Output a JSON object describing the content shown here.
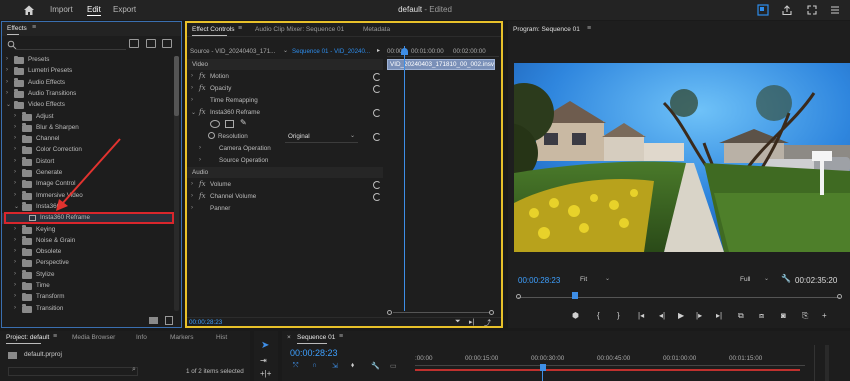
{
  "topbar": {
    "nav": [
      "Import",
      "Edit",
      "Export"
    ],
    "active_nav": "Edit",
    "doc_title": "default",
    "doc_status": "- Edited"
  },
  "effects_panel": {
    "title": "Effects",
    "tree": [
      {
        "label": "Presets",
        "level": 0,
        "state": "collapsed"
      },
      {
        "label": "Lumetri Presets",
        "level": 0,
        "state": "collapsed"
      },
      {
        "label": "Audio Effects",
        "level": 0,
        "state": "collapsed"
      },
      {
        "label": "Audio Transitions",
        "level": 0,
        "state": "collapsed"
      },
      {
        "label": "Video Effects",
        "level": 0,
        "state": "expanded"
      },
      {
        "label": "Adjust",
        "level": 1,
        "state": "collapsed"
      },
      {
        "label": "Blur & Sharpen",
        "level": 1,
        "state": "collapsed"
      },
      {
        "label": "Channel",
        "level": 1,
        "state": "collapsed"
      },
      {
        "label": "Color Correction",
        "level": 1,
        "state": "collapsed"
      },
      {
        "label": "Distort",
        "level": 1,
        "state": "collapsed"
      },
      {
        "label": "Generate",
        "level": 1,
        "state": "collapsed"
      },
      {
        "label": "Image Control",
        "level": 1,
        "state": "collapsed"
      },
      {
        "label": "Immersive Video",
        "level": 1,
        "state": "collapsed"
      },
      {
        "label": "Insta360",
        "level": 1,
        "state": "expanded"
      },
      {
        "label": "Insta360 Reframe",
        "level": 2,
        "state": "item",
        "selected": true
      },
      {
        "label": "Keying",
        "level": 1,
        "state": "collapsed"
      },
      {
        "label": "Noise & Grain",
        "level": 1,
        "state": "collapsed"
      },
      {
        "label": "Obsolete",
        "level": 1,
        "state": "collapsed"
      },
      {
        "label": "Perspective",
        "level": 1,
        "state": "collapsed"
      },
      {
        "label": "Stylize",
        "level": 1,
        "state": "collapsed"
      },
      {
        "label": "Time",
        "level": 1,
        "state": "collapsed"
      },
      {
        "label": "Transform",
        "level": 1,
        "state": "collapsed"
      },
      {
        "label": "Transition",
        "level": 1,
        "state": "collapsed"
      }
    ],
    "highlight_color": "#d9262c",
    "arrow_color": "#e2332f"
  },
  "effect_controls": {
    "tabs": [
      "Effect Controls",
      "Audio Clip Mixer: Sequence 01",
      "Metadata"
    ],
    "source_label": "Source - VID_20240403_171...",
    "sequence_label": "Sequence 01 - VID_20240...",
    "ruler_labels": [
      "00:00",
      "00:01:00:00",
      "00:02:00:00"
    ],
    "clip_name": "VID_20240403_171810_00_002.insv",
    "sections": {
      "video": "Video",
      "audio": "Audio"
    },
    "rows": {
      "motion": "Motion",
      "opacity": "Opacity",
      "time_remapping": "Time Remapping",
      "reframe": "Insta360 Reframe",
      "resolution": "Resolution",
      "resolution_value": "Original",
      "camera_operation": "Camera Operation",
      "source_operation": "Source Operation",
      "volume": "Volume",
      "channel_volume": "Channel Volume",
      "panner": "Panner"
    },
    "timecode": "00:00:28:23",
    "border_color": "#e8c12a"
  },
  "program": {
    "title": "Program: Sequence 01",
    "timecode": "00:00:28:23",
    "fit": "Fit",
    "quality": "Full",
    "duration": "00:02:35:20"
  },
  "project": {
    "tabs": [
      "Project: default",
      "Media Browser",
      "Info",
      "Markers",
      "Hist"
    ],
    "file": "default.prproj",
    "selection": "1 of 2 items selected"
  },
  "timeline": {
    "title": "Sequence 01",
    "timecode": "00:00:28:23",
    "ruler": [
      ":00:00",
      "00:00:15:00",
      "00:00:30:00",
      "00:00:45:00",
      "00:01:00:00",
      "00:01:15:00"
    ]
  },
  "accent_blue": "#2d8ceb"
}
